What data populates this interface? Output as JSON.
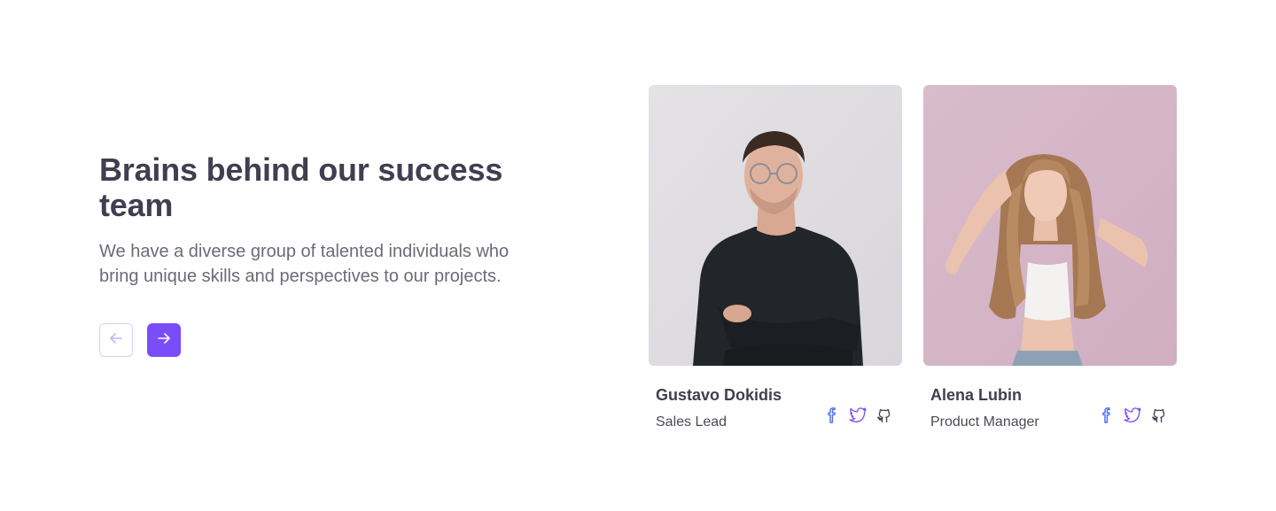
{
  "section": {
    "title": "Brains behind our success team",
    "description": "We have a diverse group of talented individuals who bring unique skills and perspectives to our projects."
  },
  "navigation": {
    "prev_icon": "arrow-left-icon",
    "next_icon": "arrow-right-icon"
  },
  "team": [
    {
      "name": "Gustavo Dokidis",
      "role": "Sales Lead",
      "photo": "man-portrait-photo",
      "socials": [
        "facebook-icon",
        "twitter-icon",
        "github-icon"
      ]
    },
    {
      "name": "Alena Lubin",
      "role": "Product Manager",
      "photo": "woman-portrait-photo",
      "socials": [
        "facebook-icon",
        "twitter-icon",
        "github-icon"
      ]
    }
  ],
  "colors": {
    "accent": "#7a4dfb",
    "accent_light": "#d9cdfb",
    "heading": "#3f3f50",
    "body": "#6b6b78",
    "facebook": "#4b6cf2",
    "twitter": "#7a4dfb",
    "github": "#3f3f50"
  }
}
